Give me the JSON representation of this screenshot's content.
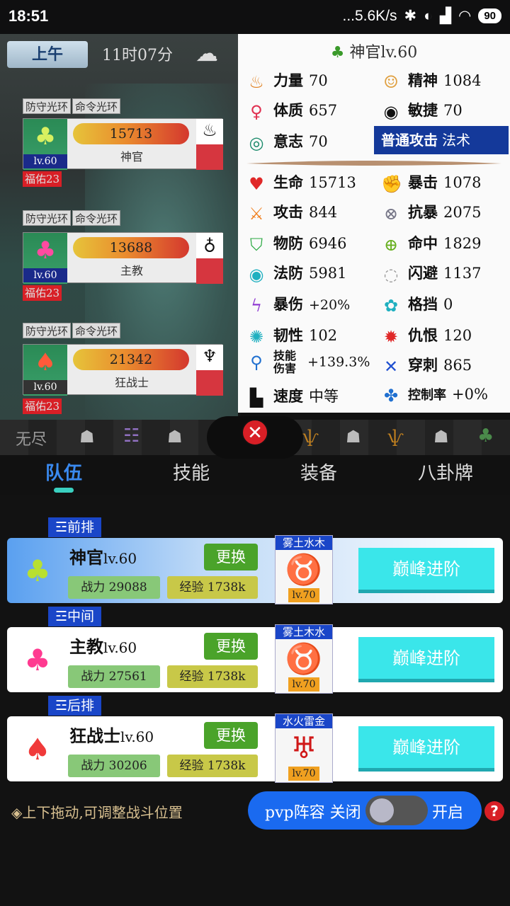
{
  "status": {
    "time": "18:51",
    "net": "...5.6K/s",
    "battery": "90"
  },
  "scene": {
    "day": "上午",
    "clock": "11时07分",
    "cards": [
      {
        "auras": [
          "防守光环",
          "命令光环"
        ],
        "hp": "15713",
        "name": "神官",
        "lvl": "lv.60",
        "fuyou": "福佑",
        "fuyou_n": "23"
      },
      {
        "auras": [
          "防守光环",
          "命令光环"
        ],
        "hp": "13688",
        "name": "主教",
        "lvl": "lv.60",
        "fuyou": "福佑",
        "fuyou_n": "23"
      },
      {
        "auras": [
          "防守光环",
          "命令光环"
        ],
        "hp": "21342",
        "name": "狂战士",
        "lvl": "lv.60",
        "fuyou": "福佑",
        "fuyou_n": "23"
      }
    ]
  },
  "stats": {
    "header": "神官lv.60",
    "base": [
      {
        "label": "力量",
        "value": "70"
      },
      {
        "label": "精神",
        "value": "1084"
      },
      {
        "label": "体质",
        "value": "657"
      },
      {
        "label": "敏捷",
        "value": "70"
      },
      {
        "label": "意志",
        "value": "70"
      }
    ],
    "attack_type_label": "普通攻击",
    "attack_type_value": "法术",
    "combat": [
      {
        "label": "生命",
        "value": "15713"
      },
      {
        "label": "暴击",
        "value": "1078"
      },
      {
        "label": "攻击",
        "value": "844"
      },
      {
        "label": "抗暴",
        "value": "2075"
      },
      {
        "label": "物防",
        "value": "6946"
      },
      {
        "label": "命中",
        "value": "1829"
      },
      {
        "label": "法防",
        "value": "5981"
      },
      {
        "label": "闪避",
        "value": "1137"
      },
      {
        "label": "暴伤",
        "value": "+20%"
      },
      {
        "label": "格挡",
        "value": "0"
      },
      {
        "label": "韧性",
        "value": "102"
      },
      {
        "label": "仇恨",
        "value": "120"
      },
      {
        "label": "技能伤害",
        "value": "+139.3%"
      },
      {
        "label": "穿刺",
        "value": "865"
      },
      {
        "label": "速度",
        "value": "中等"
      },
      {
        "label": "控制率",
        "value": "+0%"
      }
    ]
  },
  "path_label": "无尽",
  "tabs": [
    "队伍",
    "技能",
    "装备",
    "八卦牌"
  ],
  "rows": [
    {
      "pos": "☲前排",
      "name": "神官",
      "lvl": "lv.60",
      "change": "更换",
      "power_label": "战力",
      "power": "29088",
      "exp_label": "经验",
      "exp": "1738k",
      "pet_elem": "雾土水木",
      "pet_lvl": "lv.70",
      "adv": "巅峰进阶"
    },
    {
      "pos": "☲中间",
      "name": "主教",
      "lvl": "lv.60",
      "change": "更换",
      "power_label": "战力",
      "power": "27561",
      "exp_label": "经验",
      "exp": "1738k",
      "pet_elem": "雾土木水",
      "pet_lvl": "lv.70",
      "adv": "巅峰进阶"
    },
    {
      "pos": "☲后排",
      "name": "狂战士",
      "lvl": "lv.60",
      "change": "更换",
      "power_label": "战力",
      "power": "30206",
      "exp_label": "经验",
      "exp": "1738k",
      "pet_elem": "水火雷金",
      "pet_lvl": "lv.70",
      "adv": "巅峰进阶"
    }
  ],
  "hint": "◈上下拖动,可调整战斗位置",
  "pvp": {
    "label": "pvp阵容 关闭",
    "on_label": "开启"
  },
  "help": "?"
}
